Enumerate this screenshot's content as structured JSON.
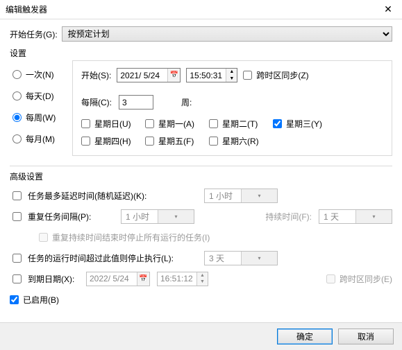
{
  "window": {
    "title": "编辑触发器"
  },
  "begin": {
    "label": "开始任务(G):",
    "value": "按预定计划"
  },
  "settings_label": "设置",
  "freq": {
    "once": {
      "label": "一次(N)",
      "checked": false
    },
    "daily": {
      "label": "每天(D)",
      "checked": false
    },
    "weekly": {
      "label": "每周(W)",
      "checked": true
    },
    "monthly": {
      "label": "每月(M)",
      "checked": false
    }
  },
  "start": {
    "label": "开始(S):",
    "date": "2021/ 5/24",
    "time": "15:50:31",
    "tz_sync": {
      "label": "跨时区同步(Z)",
      "checked": false
    }
  },
  "recur": {
    "every_label": "每隔(C):",
    "every_value": "3",
    "unit_label": "周:"
  },
  "days": {
    "sun": {
      "label": "星期日(U)",
      "checked": false
    },
    "mon": {
      "label": "星期一(A)",
      "checked": false
    },
    "tue": {
      "label": "星期二(T)",
      "checked": false
    },
    "wed": {
      "label": "星期三(Y)",
      "checked": true
    },
    "thu": {
      "label": "星期四(H)",
      "checked": false
    },
    "fri": {
      "label": "星期五(F)",
      "checked": false
    },
    "sat": {
      "label": "星期六(R)",
      "checked": false
    }
  },
  "adv_label": "高级设置",
  "adv": {
    "random_delay": {
      "label": "任务最多延迟时间(随机延迟)(K):",
      "checked": false,
      "value": "1 小时"
    },
    "repeat": {
      "label": "重复任务间隔(P):",
      "checked": false,
      "value": "1 小时",
      "duration_label": "持续时间(F):",
      "duration_value": "1 天"
    },
    "repeat_stop": {
      "label": "重复持续时间结束时停止所有运行的任务(I)",
      "checked": false
    },
    "stop_after": {
      "label": "任务的运行时间超过此值则停止执行(L):",
      "checked": false,
      "value": "3 天"
    },
    "expire": {
      "label": "到期日期(X):",
      "checked": false,
      "date": "2022/ 5/24",
      "time": "16:51:12",
      "tz_label": "跨时区同步(E)"
    },
    "enabled": {
      "label": "已启用(B)",
      "checked": true
    }
  },
  "buttons": {
    "ok": "确定",
    "cancel": "取消"
  },
  "glyph": {
    "cal": "📅",
    "up": "▲",
    "down": "▼",
    "dd": "▾",
    "close": "✕"
  }
}
